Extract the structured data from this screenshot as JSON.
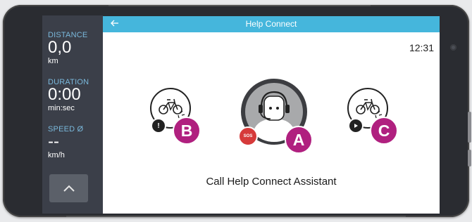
{
  "sidebar": {
    "distance": {
      "label": "DISTANCE",
      "value": "0,0",
      "unit": "km"
    },
    "duration": {
      "label": "DURATION",
      "value": "0:00",
      "unit": "min:sec"
    },
    "speed": {
      "label": "SPEED Ø",
      "value": "--",
      "unit": "km/h"
    },
    "up_button_icon": "chevron-up-icon"
  },
  "header": {
    "title": "Help Connect",
    "back_icon": "back-arrow-icon"
  },
  "status": {
    "time": "12:31"
  },
  "options": [
    {
      "letter": "B",
      "icon": "bike-alert-icon",
      "badge_icon": "exclamation-icon"
    },
    {
      "letter": "A",
      "icon": "assistant-headset-icon",
      "badge_icon": "sos-call-icon",
      "badge_text": "SOS"
    },
    {
      "letter": "C",
      "icon": "bike-play-icon",
      "badge_icon": "play-icon"
    }
  ],
  "call_text": "Call Help Connect Assistant",
  "colors": {
    "header": "#45b6dc",
    "sidebar": "#3b3f49",
    "label": "#7ab8db",
    "letter_badge": "#b0207f",
    "sos_badge": "#d63a3a"
  }
}
